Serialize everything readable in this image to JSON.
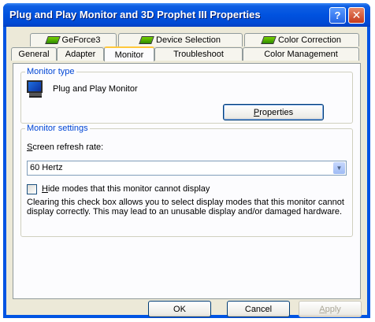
{
  "window": {
    "title": "Plug and Play Monitor and 3D Prophet III Properties",
    "help_label": "?",
    "close_label": "✕"
  },
  "tabs_row1": [
    {
      "label": "GeForce3",
      "icon": "geforce-icon"
    },
    {
      "label": "Device Selection",
      "icon": "device-selection-icon"
    },
    {
      "label": "Color Correction",
      "icon": "color-correction-icon"
    }
  ],
  "tabs_row2": [
    {
      "label": "General"
    },
    {
      "label": "Adapter"
    },
    {
      "label": "Monitor",
      "selected": true
    },
    {
      "label": "Troubleshoot"
    },
    {
      "label": "Color Management"
    }
  ],
  "monitor_type": {
    "heading": "Monitor type",
    "name": "Plug and Play Monitor",
    "properties_key": "P",
    "properties_rest": "roperties"
  },
  "monitor_settings": {
    "heading": "Monitor settings",
    "refresh_key": "S",
    "refresh_rest": "creen refresh rate:",
    "refresh_value": "60 Hertz",
    "hide_key": "H",
    "hide_rest": "ide modes that this monitor cannot display",
    "description": "Clearing this check box allows you to select display modes that this monitor cannot display correctly. This may lead to an unusable display and/or damaged hardware."
  },
  "buttons": {
    "ok": "OK",
    "cancel": "Cancel",
    "apply_key": "A",
    "apply_rest": "pply"
  },
  "colors": {
    "titlebar": "#0054e3",
    "dialog_bg": "#ece9d8",
    "group_heading": "#0046d5",
    "selected_tab_accent": "#ffc83c"
  }
}
